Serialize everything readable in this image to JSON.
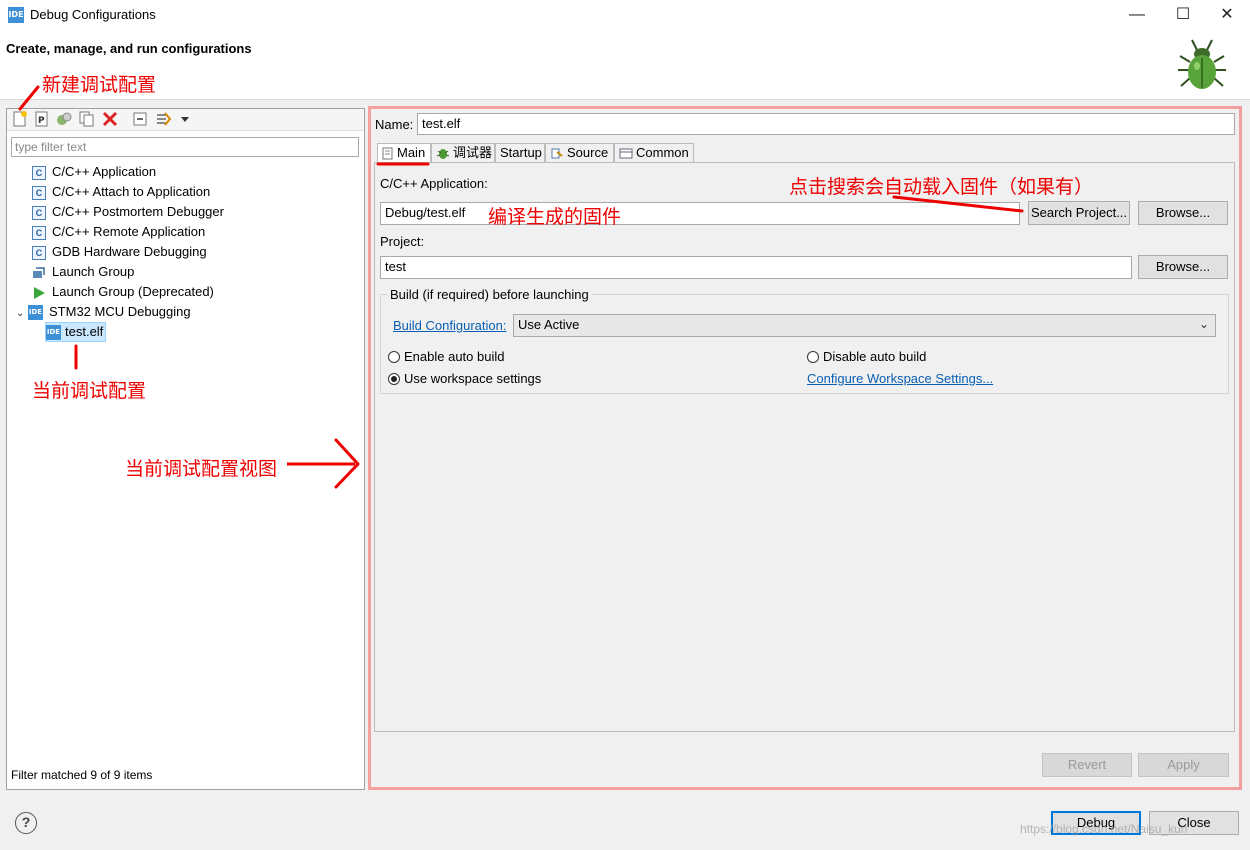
{
  "window": {
    "title": "Debug Configurations",
    "icon_text": "IDE",
    "controls": {
      "minimize": "—",
      "maximize": "☐",
      "close": "✕"
    }
  },
  "header": {
    "title": "Create, manage, and run configurations",
    "logo_icon": "bug-icon"
  },
  "left_panel": {
    "filter_placeholder": "type filter text",
    "tree": [
      {
        "label": "C/C++ Application",
        "icon": "c"
      },
      {
        "label": "C/C++ Attach to Application",
        "icon": "c"
      },
      {
        "label": "C/C++ Postmortem Debugger",
        "icon": "c"
      },
      {
        "label": "C/C++ Remote Application",
        "icon": "c"
      },
      {
        "label": "GDB Hardware Debugging",
        "icon": "c"
      },
      {
        "label": "Launch Group",
        "icon": "launch-group"
      },
      {
        "label": "Launch Group (Deprecated)",
        "icon": "launch-deprecated"
      },
      {
        "label": "STM32 MCU Debugging",
        "icon": "ide"
      },
      {
        "label": "test.elf",
        "icon": "ide"
      }
    ],
    "status": "Filter matched 9 of 9 items"
  },
  "right_panel": {
    "name_label": "Name:",
    "name_value": "test.elf",
    "tabs": [
      {
        "label": "Main"
      },
      {
        "label": "调试器"
      },
      {
        "label": "Startup"
      },
      {
        "label": "Source"
      },
      {
        "label": "Common"
      }
    ],
    "app_label": "C/C++ Application:",
    "app_value": "Debug/test.elf",
    "search_project": "Search Project...",
    "browse": "Browse...",
    "project_label": "Project:",
    "project_value": "test",
    "browse2": "Browse...",
    "build_group_title": "Build (if required) before launching",
    "build_config_link": "Build Configuration:",
    "build_config_value": "Use Active",
    "enable_auto_build": "Enable auto build",
    "disable_auto_build": "Disable auto build",
    "use_workspace": "Use workspace settings",
    "configure_workspace": "Configure Workspace Settings...",
    "revert": "Revert",
    "apply": "Apply"
  },
  "footer": {
    "debug": "Debug",
    "close": "Close"
  },
  "annotations": {
    "new_config": "新建调试配置",
    "current_config": "当前调试配置",
    "current_view": "当前调试配置视图",
    "compiled_firmware": "编译生成的固件",
    "search_hint": "点击搜索会自动载入固件（如果有）"
  },
  "watermark": "https://blog.csdn.net/Naisu_kun",
  "colors": {
    "annotation": "#e00000",
    "link": "#0a5fb4",
    "selection": "#cce8ff",
    "panel_highlight": "#f4a0a0"
  }
}
